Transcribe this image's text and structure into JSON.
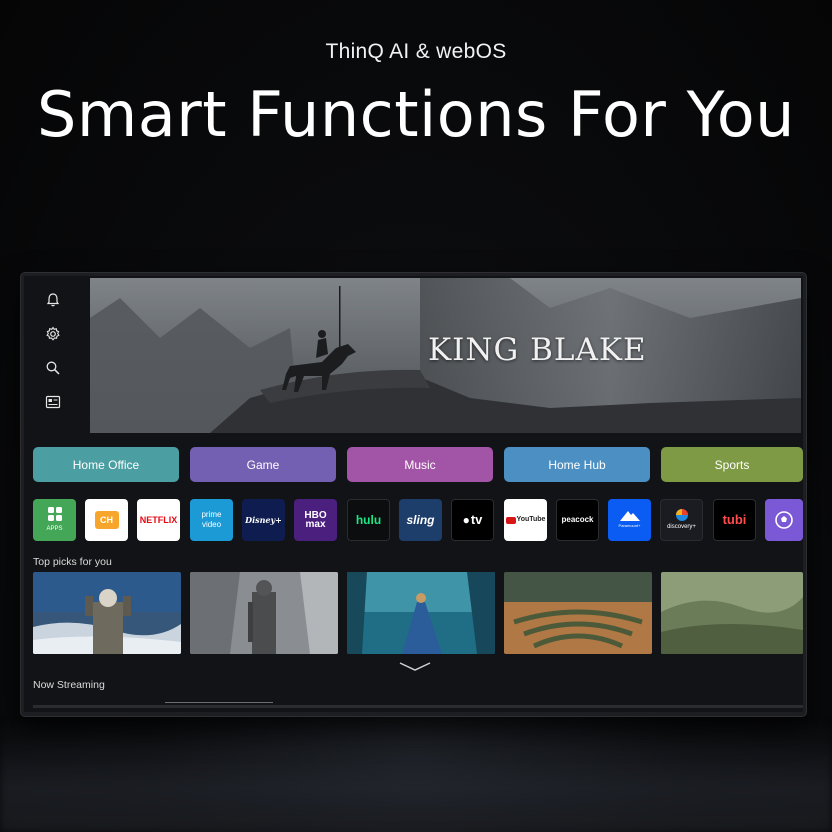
{
  "header": {
    "subtitle": "ThinQ AI & webOS",
    "headline": "Smart Functions For You"
  },
  "side_menu": {
    "icons": [
      "bell-icon",
      "gear-icon",
      "search-icon",
      "guide-icon"
    ]
  },
  "hero": {
    "title": "KING BLAKE"
  },
  "category_tiles": [
    {
      "label": "Home Office",
      "color": "#4b9fa2"
    },
    {
      "label": "Game",
      "color": "#7460b3"
    },
    {
      "label": "Music",
      "color": "#a254a6"
    },
    {
      "label": "Home Hub",
      "color": "#4c8fc2"
    },
    {
      "label": "Sports",
      "color": "#7f9a44"
    }
  ],
  "apps": [
    {
      "name": "apps",
      "label": "APPS",
      "bg": "#44a657",
      "fg": "#ffffff"
    },
    {
      "name": "lg-channels",
      "label": "CH",
      "bg": "#ffffff",
      "fg": "#f08a1e"
    },
    {
      "name": "netflix",
      "label": "NETFLIX",
      "bg": "#ffffff",
      "fg": "#e50914"
    },
    {
      "name": "prime-video",
      "label": "prime video",
      "bg": "#1b9ad6",
      "fg": "#ffffff"
    },
    {
      "name": "disney-plus",
      "label": "Disney+",
      "bg": "#0e1c4f",
      "fg": "#ffffff"
    },
    {
      "name": "hbo-max",
      "label": "HBO max",
      "bg": "#4a1f7e",
      "fg": "#ffffff"
    },
    {
      "name": "hulu",
      "label": "hulu",
      "bg": "#0c0d0f",
      "fg": "#1ce783"
    },
    {
      "name": "sling",
      "label": "sling",
      "bg": "#1d3d6b",
      "fg": "#ffffff"
    },
    {
      "name": "apple-tv",
      "label": "tv",
      "bg": "#000000",
      "fg": "#ffffff"
    },
    {
      "name": "youtube",
      "label": "YouTube",
      "bg": "#ffffff",
      "fg": "#d91616"
    },
    {
      "name": "peacock",
      "label": "peacock",
      "bg": "#000000",
      "fg": "#ffffff"
    },
    {
      "name": "paramount-plus",
      "label": "Paramount+",
      "bg": "#0a5cf2",
      "fg": "#ffffff"
    },
    {
      "name": "discovery-plus",
      "label": "discovery+",
      "bg": "#1a1c22",
      "fg": "#ffffff"
    },
    {
      "name": "tubi",
      "label": "tubi",
      "bg": "#000000",
      "fg": "#ff4d4d"
    },
    {
      "name": "sports-app",
      "label": "",
      "bg": "#7a58d6",
      "fg": "#ffffff"
    }
  ],
  "sections": {
    "top_picks": "Top picks for you",
    "now_streaming": "Now Streaming"
  },
  "top_picks": [
    {
      "name": "pick-astronaut"
    },
    {
      "name": "pick-knight-statue"
    },
    {
      "name": "pick-blue-forest"
    },
    {
      "name": "pick-maze"
    },
    {
      "name": "pick-green-hills"
    }
  ]
}
